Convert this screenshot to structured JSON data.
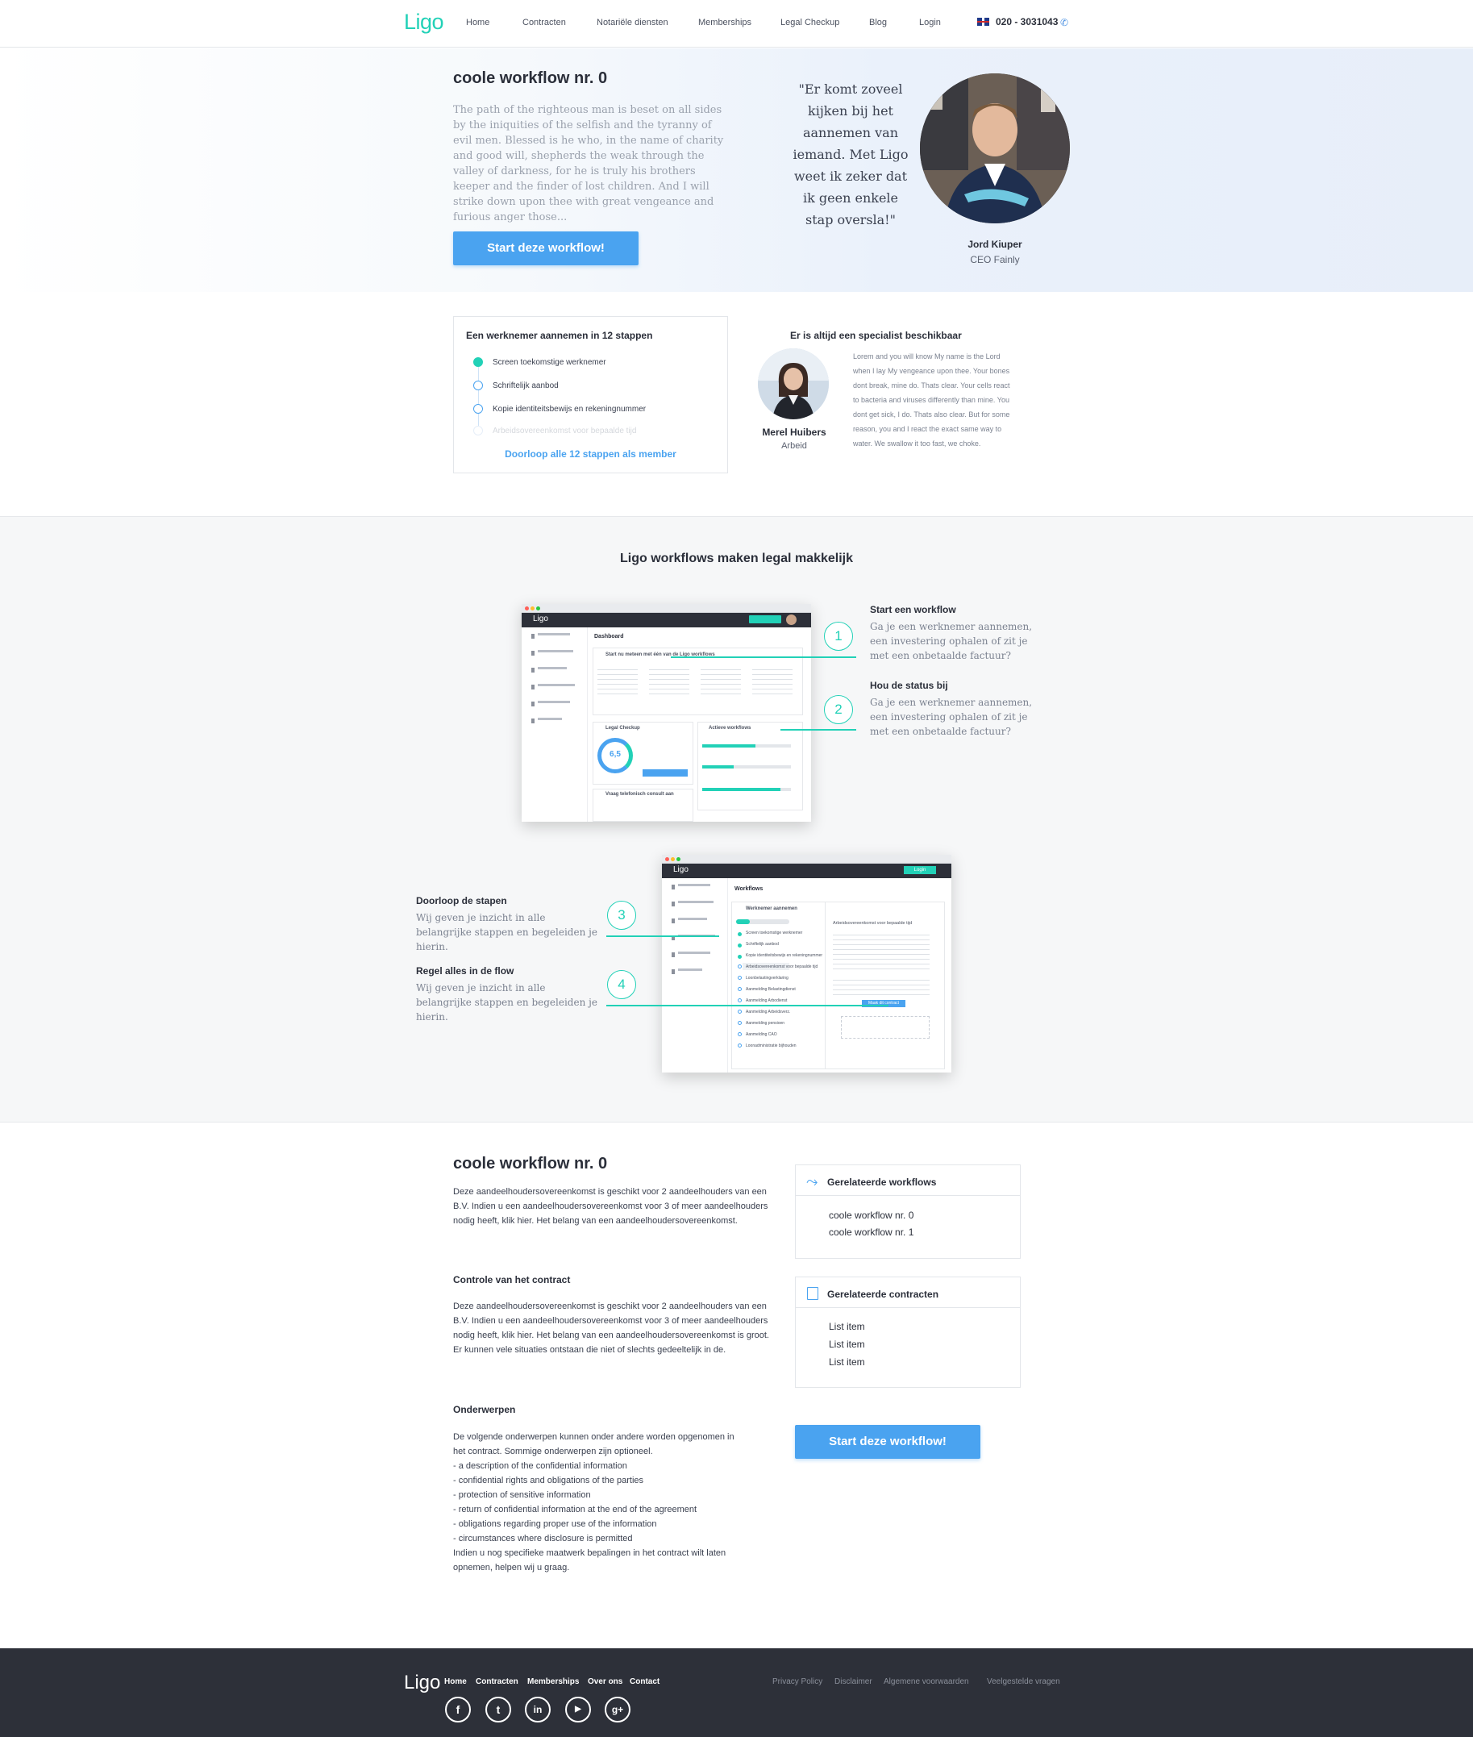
{
  "header": {
    "logo": "Ligo",
    "nav": [
      "Home",
      "Contracten",
      "Notariële diensten",
      "Memberships",
      "Legal Checkup",
      "Blog",
      "Login"
    ],
    "phone": "020 - 3031043"
  },
  "hero": {
    "title": "coole workflow nr. 0",
    "text": "The path of the righteous man is beset on all sides by the iniquities of the selfish and the tyranny of evil men. Blessed is he who, in the name of charity and good will, shepherds the weak through the valley of darkness, for he is truly his brothers keeper and the finder of lost children. And I will strike down upon thee with great vengeance and furious anger those...",
    "button": "Start deze workflow!",
    "quote": "\"Er komt zoveel kijken bij het aannemen van iemand. Met Ligo weet ik zeker dat ik geen enkele stap oversla!\"",
    "person_name": "Jord Kiuper",
    "person_role": "CEO Fainly"
  },
  "steps": {
    "title": "Een werknemer aannemen in 12 stappen",
    "items": [
      "Screen toekomstige werknemer",
      "Schriftelijk aanbod",
      "Kopie identiteitsbewijs en rekeningnummer",
      "Arbeidsovereenkomst voor bepaalde tijd"
    ],
    "link": "Doorloop alle 12 stappen als member"
  },
  "specialist": {
    "title": "Er is altijd een specialist beschikbaar",
    "name": "Merel Huibers",
    "role": "Arbeid",
    "text": "Lorem and you will know My name is the Lord when I lay My vengeance upon thee. Your bones dont break, mine do. Thats clear. Your cells react to bacteria and viruses differently than mine. You dont get sick, I do. Thats also clear. But for some reason, you and I react the exact same way to water. We swallow it too fast, we choke."
  },
  "features": {
    "title": "Ligo workflows maken legal makkelijk",
    "items": [
      {
        "num": "1",
        "title": "Start een workflow",
        "text": "Ga je een werknemer aannemen, een investering ophalen of zit je met een onbetaalde factuur?"
      },
      {
        "num": "2",
        "title": "Hou de status bij",
        "text": "Ga je een werknemer aannemen, een investering ophalen of zit je met een onbetaalde factuur?"
      },
      {
        "num": "3",
        "title": "Doorloop de stapen",
        "text": "Wij geven je inzicht in alle belangrijke stappen en begeleiden je hierin."
      },
      {
        "num": "4",
        "title": "Regel alles in de flow",
        "text": "Wij geven je inzicht in alle belangrijke stappen en begeleiden je hierin."
      }
    ],
    "shot1": {
      "logo": "Ligo",
      "heading": "Dashboard",
      "start_title": "Start nu meteen met één van de Ligo workflows",
      "score": "6,5",
      "checkup": "Legal Checkup",
      "active": "Actieve workflows",
      "question": "Vraag telefonisch consult aan"
    },
    "shot2": {
      "logo": "Ligo",
      "heading": "Workflows",
      "panel_title": "Werknemer aannemen",
      "detail_title": "Arbeidsovereenkomst voor bepaalde tijd",
      "steps": [
        "Screen toekomstige werknemer",
        "Schriftelijk aanbod",
        "Kopie identiteitsbewijs en rekeningnummer",
        "Arbeidsovereenkomst voor bepaalde tijd",
        "Loonbelastingverklaring",
        "Aanmelding Belastingdienst",
        "Aanmelding Arbodienst",
        "Aanmelding Arbeidsverz.",
        "Aanmelding pensioen",
        "Aanmelding CAO",
        "Loonadministratie bijhouden"
      ],
      "button": "Maak dit contract",
      "login": "Login"
    }
  },
  "detail": {
    "title": "coole workflow nr. 0",
    "intro": "Deze aandeelhoudersovereenkomst is geschikt voor 2 aandeelhouders van een B.V. Indien u een aandeelhoudersovereenkomst voor 3 of meer aandeelhouders nodig heeft, klik hier. Het belang van een aandeelhoudersovereenkomst.",
    "controle_title": "Controle van het contract",
    "controle_text": "Deze aandeelhoudersovereenkomst is geschikt voor 2 aandeelhouders van een B.V. Indien u een aandeelhoudersovereenkomst voor 3 of meer aandeelhouders nodig heeft, klik hier. Het belang van een aandeelhoudersovereenkomst is groot. Er kunnen vele situaties ontstaan die niet of slechts gedeeltelijk in de.",
    "onderwerpen_title": "Onderwerpen",
    "onderwerpen_lines": [
      "De volgende onderwerpen kunnen onder andere worden opgenomen in",
      "het contract. Sommige onderwerpen zijn optioneel.",
      "- a description of the confidential information",
      "- confidential rights and obligations of the parties",
      "- protection of sensitive information",
      "- return of confidential information at the end of the agreement",
      "- obligations regarding proper use of the information",
      "- circumstances where disclosure is permitted",
      "Indien u nog specifieke maatwerk bepalingen in het contract wilt laten",
      "opnemen, helpen wij u graag."
    ],
    "related_workflows_title": "Gerelateerde workflows",
    "related_workflows": [
      "coole workflow nr. 0",
      "coole workflow nr. 1"
    ],
    "related_contracts_title": "Gerelateerde contracten",
    "related_contracts": [
      "List item",
      "List item",
      "List item"
    ],
    "button": "Start deze workflow!"
  },
  "footer": {
    "logo": "Ligo",
    "links": [
      "Home",
      "Contracten",
      "Memberships",
      "Over ons",
      "Contact"
    ],
    "legal": [
      "Privacy Policy",
      "Disclaimer",
      "Algemene voorwaarden",
      "Veelgestelde vragen"
    ],
    "social_icons": [
      "facebook-icon",
      "twitter-icon",
      "linkedin-icon",
      "youtube-icon",
      "google-plus-icon"
    ]
  },
  "colors": {
    "accent": "#22d1b7",
    "button": "#4aa3f0",
    "footer": "#2d3039"
  }
}
